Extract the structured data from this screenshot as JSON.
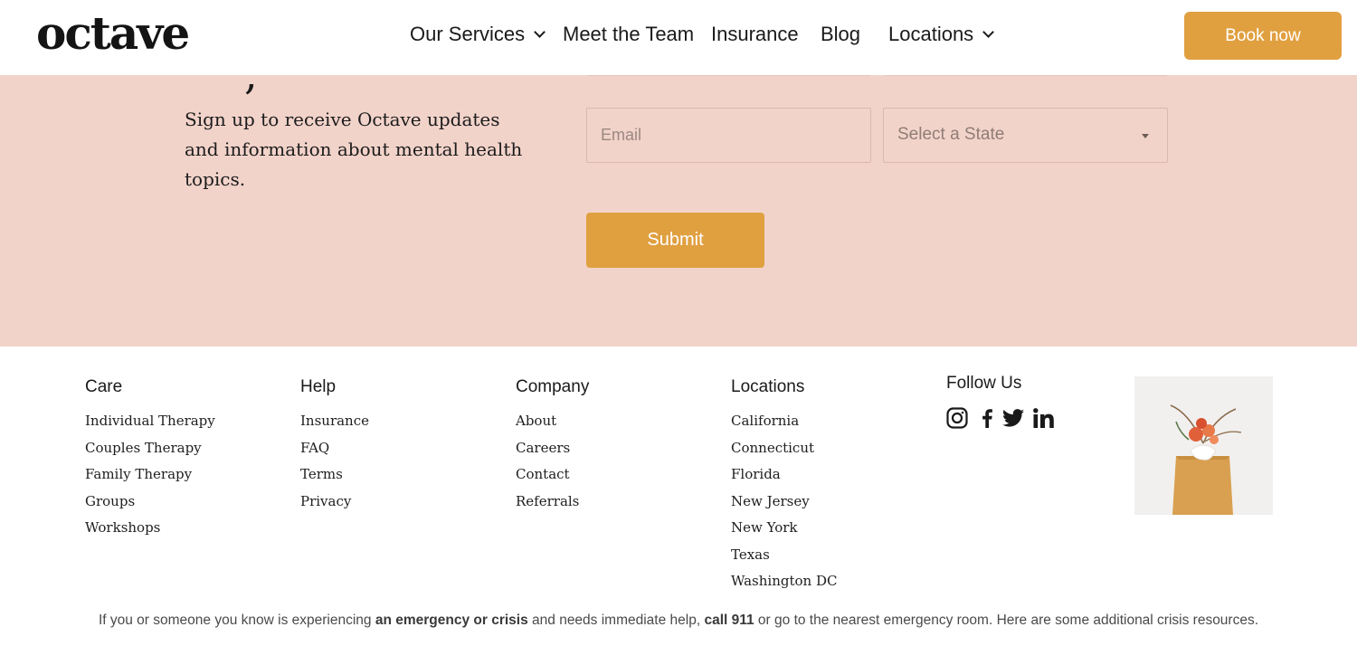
{
  "nav": {
    "logo": "octave",
    "items": [
      {
        "label": "Our Services",
        "dropdown": true
      },
      {
        "label": "Meet the Team",
        "dropdown": false
      },
      {
        "label": "Insurance",
        "dropdown": false
      },
      {
        "label": "Blog",
        "dropdown": false
      },
      {
        "label": "Locations",
        "dropdown": true
      }
    ],
    "book_label": "Book now"
  },
  "newsletter": {
    "description": "Sign up to receive Octave updates and information about mental health topics.",
    "email_placeholder": "Email",
    "state_placeholder": "Select a State",
    "submit_label": "Submit"
  },
  "footer": {
    "columns": [
      {
        "title": "Care",
        "links": [
          "Individual Therapy",
          "Couples Therapy",
          "Family Therapy",
          "Groups",
          "Workshops"
        ]
      },
      {
        "title": "Help",
        "links": [
          "Insurance",
          "FAQ",
          "Terms",
          "Privacy"
        ]
      },
      {
        "title": "Company",
        "links": [
          "About",
          "Careers",
          "Contact",
          "Referrals"
        ]
      },
      {
        "title": "Locations",
        "links": [
          "California",
          "Connecticut",
          "Florida",
          "New Jersey",
          "New York",
          "Texas",
          "Washington DC"
        ]
      }
    ],
    "follow_title": "Follow Us",
    "social_icons": [
      "instagram-icon",
      "facebook-icon",
      "twitter-icon",
      "linkedin-icon"
    ]
  },
  "crisis": {
    "part1": "If you or someone you know is experiencing ",
    "link1": "an emergency or crisis",
    "part2": " and needs immediate help, ",
    "link2": "call 911",
    "part3": " or go to the nearest emergency room. Here are some additional crisis resources."
  },
  "colors": {
    "accent": "#e0a040",
    "newsletter_bg": "#f2d3ca"
  }
}
